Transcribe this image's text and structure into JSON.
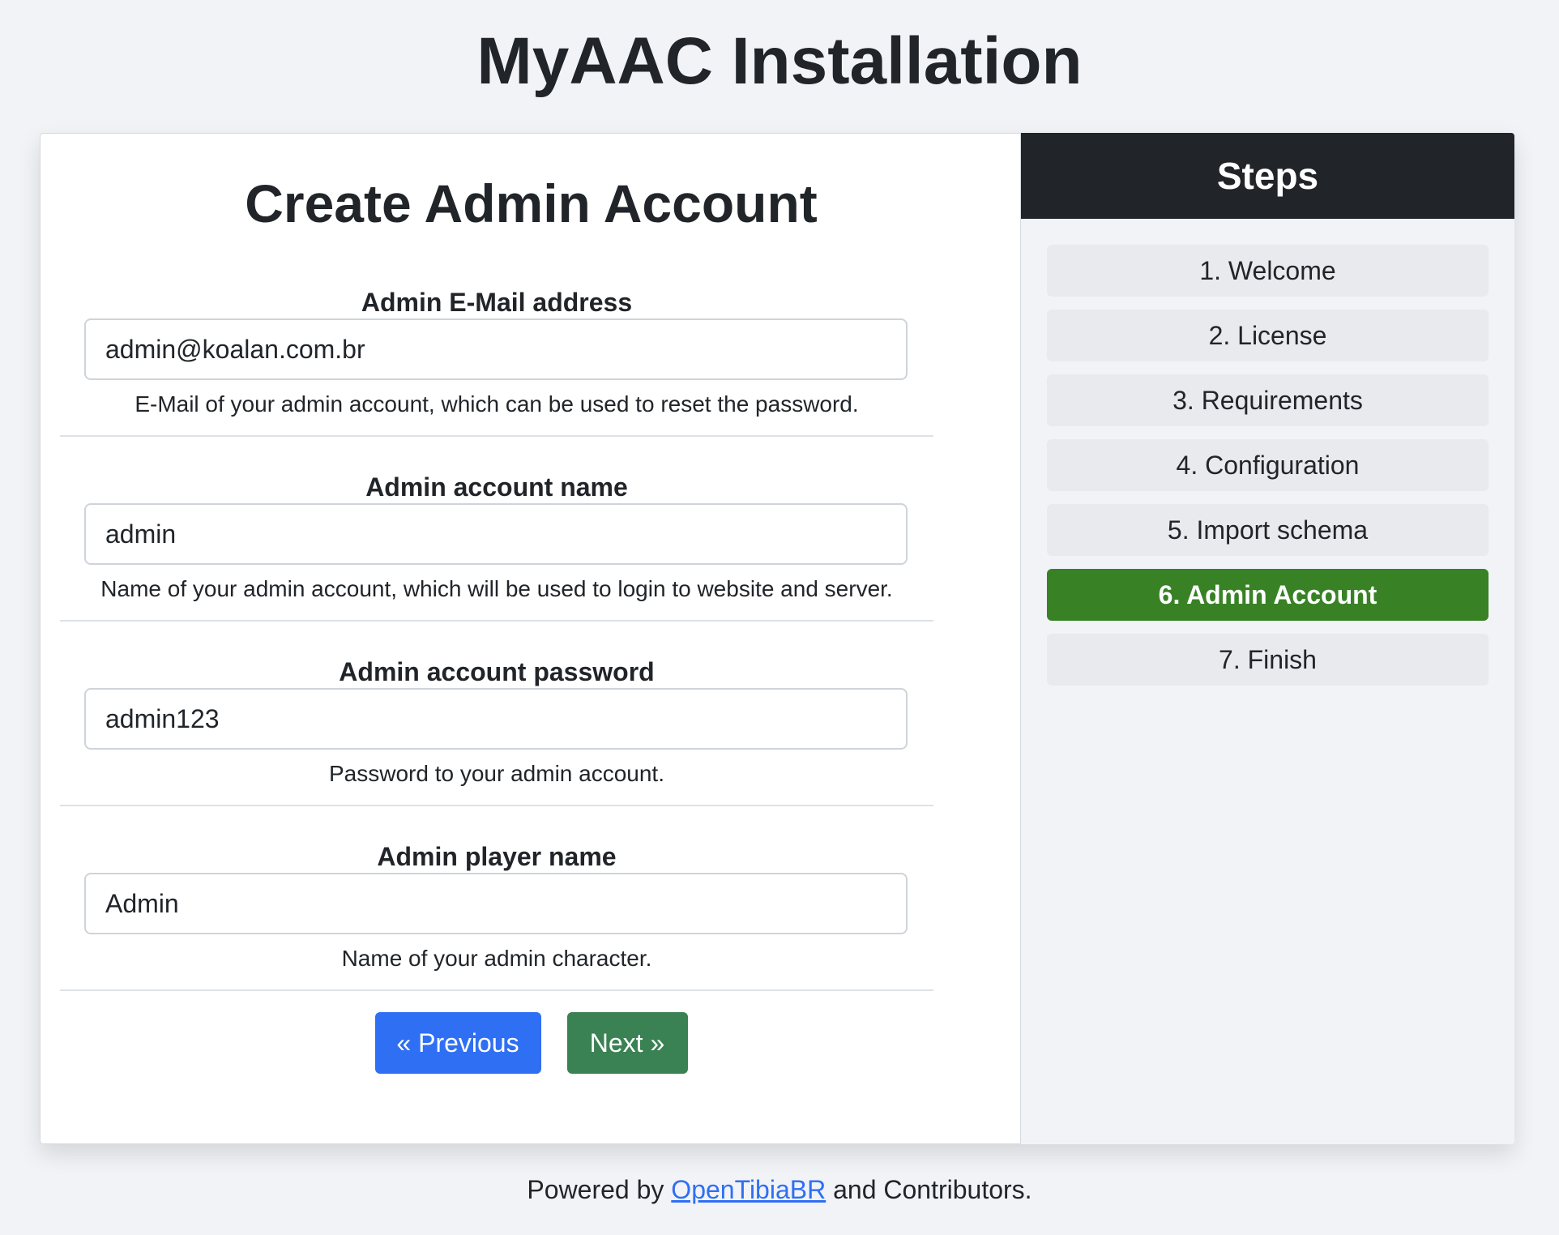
{
  "page": {
    "title": "MyAAC Installation"
  },
  "form": {
    "title": "Create Admin Account",
    "fields": [
      {
        "label": "Admin E-Mail address",
        "value": "admin@koalan.com.br",
        "help": "E-Mail of your admin account, which can be used to reset the password."
      },
      {
        "label": "Admin account name",
        "value": "admin",
        "help": "Name of your admin account, which will be used to login to website and server."
      },
      {
        "label": "Admin account password",
        "value": "admin123",
        "help": "Password to your admin account."
      },
      {
        "label": "Admin player name",
        "value": "Admin",
        "help": "Name of your admin character."
      }
    ],
    "previous_label": "« Previous",
    "next_label": "Next »"
  },
  "steps": {
    "title": "Steps",
    "items": [
      {
        "label": "1. Welcome",
        "active": false
      },
      {
        "label": "2. License",
        "active": false
      },
      {
        "label": "3. Requirements",
        "active": false
      },
      {
        "label": "4. Configuration",
        "active": false
      },
      {
        "label": "5. Import schema",
        "active": false
      },
      {
        "label": "6. Admin Account",
        "active": true
      },
      {
        "label": "7. Finish",
        "active": false
      }
    ]
  },
  "footer": {
    "prefix": "Powered by",
    "link_text": "OpenTibiaBR",
    "suffix": "and Contributors."
  },
  "colors": {
    "background": "#f1f3f7",
    "primary": "#2f6ff3",
    "success": "#3a8253",
    "active_step": "#388225",
    "dark_header": "#212529"
  }
}
